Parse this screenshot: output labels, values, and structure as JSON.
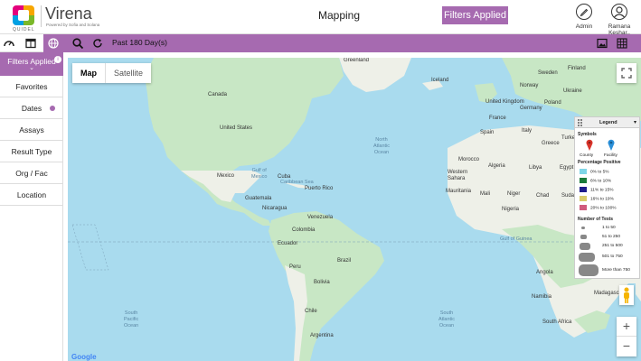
{
  "header": {
    "logo_text": "QUIDEL",
    "brand": "Virena",
    "brand_sub": "Powered by Sofia and Solana",
    "title": "Mapping",
    "filters_button": "Filters Applied",
    "admin_label": "Admin",
    "user_label": "Ramana Keshar.."
  },
  "toolbar": {
    "date_range": "Past 180 Day(s)"
  },
  "sidebar": {
    "head": "Filters Applied",
    "badge": "i",
    "items": [
      {
        "label": "Favorites"
      },
      {
        "label": "Dates"
      },
      {
        "label": "Assays"
      },
      {
        "label": "Result Type"
      },
      {
        "label": "Org / Fac"
      },
      {
        "label": "Location"
      }
    ]
  },
  "map": {
    "type_map": "Map",
    "type_satellite": "Satellite",
    "zoom_in": "+",
    "zoom_out": "−",
    "google": "Google",
    "oceans": {
      "north_atlantic": "North\nAtlantic\nOcean",
      "south_pacific": "South\nPacific\nOcean",
      "south_atlantic": "South\nAtlantic\nOcean",
      "gulf_mexico": "Gulf of\nMexico",
      "caribbean": "Caribbean Sea"
    },
    "labels": {
      "greenland": "Greenland",
      "iceland": "Iceland",
      "canada": "Canada",
      "us": "United States",
      "mexico": "Mexico",
      "cuba": "Cuba",
      "puerto_rico": "Puerto Rico",
      "guatemala": "Guatemala",
      "nicaragua": "Nicaragua",
      "venezuela": "Venezuela",
      "colombia": "Colombia",
      "ecuador": "Ecuador",
      "peru": "Peru",
      "brazil": "Brazil",
      "bolivia": "Bolivia",
      "chile": "Chile",
      "argentina": "Argentina",
      "uk": "United Kingdom",
      "sweden": "Sweden",
      "finland": "Finland",
      "norway": "Norway",
      "poland": "Poland",
      "ukraine": "Ukraine",
      "germany": "Germany",
      "france": "France",
      "spain": "Spain",
      "italy": "Italy",
      "greece": "Greece",
      "turkey": "Turkey",
      "morocco": "Morocco",
      "algeria": "Algeria",
      "libya": "Libya",
      "egypt": "Egypt",
      "western_sahara": "Western\nSahara",
      "mauritania": "Mauritania",
      "mali": "Mali",
      "niger": "Niger",
      "chad": "Chad",
      "sudan": "Sudan",
      "nigeria": "Nigeria",
      "gulf_guinea": "Gulf of Guinea",
      "angola": "Angola",
      "namibia": "Namibia",
      "south_africa": "South Africa",
      "madagascar": "Madagascar"
    }
  },
  "legend": {
    "title": "Legend",
    "symbols_head": "Symbols",
    "county": "County",
    "facility": "Facility",
    "pct_head": "Percentage Positive",
    "pct_rows": [
      {
        "label": "0% to 5%",
        "color": "#7fd6e8"
      },
      {
        "label": "6% to 10%",
        "color": "#1a7a3a"
      },
      {
        "label": "11% to 15%",
        "color": "#1e1c8c"
      },
      {
        "label": "16% to 19%",
        "color": "#d9cb6a"
      },
      {
        "label": "20% to 100%",
        "color": "#d05a7c"
      }
    ],
    "count_head": "Number of Tests",
    "count_rows": [
      {
        "label": "1 to 50"
      },
      {
        "label": "51 to 250"
      },
      {
        "label": "251 to 500"
      },
      {
        "label": "501 to 750"
      },
      {
        "label": "More than 750"
      }
    ]
  },
  "colors": {
    "accent": "#a66ab0",
    "ocean": "#a9dbee",
    "land": "#eef0e8",
    "green_land": "#c5e6c4"
  }
}
